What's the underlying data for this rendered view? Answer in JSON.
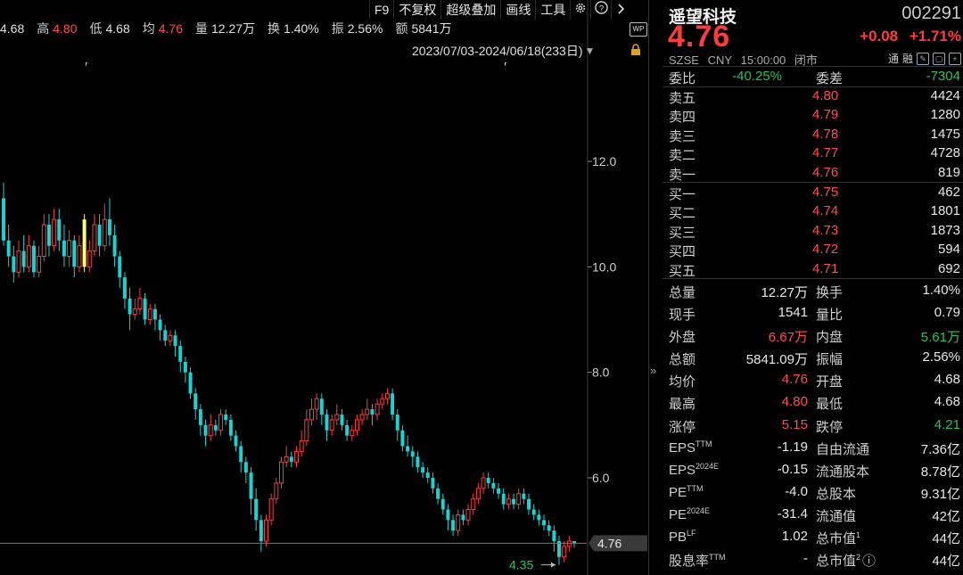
{
  "quote_bar": {
    "open_value": "4.68",
    "high_label": "高",
    "high_value": "4.80",
    "low_label": "低",
    "low_value": "4.68",
    "avg_label": "均",
    "avg_value": "4.76",
    "volume_label": "量",
    "volume_value": "12.27万",
    "turnover_label": "换",
    "turnover_value": "1.40%",
    "amplitude_label": "振",
    "amplitude_value": "2.56%",
    "amount_label": "额",
    "amount_value": "5841万"
  },
  "toolbar": {
    "f9": "F9",
    "no_adjust": "不复权",
    "overlay": "超级叠加",
    "draw": "画线",
    "tools": "工具",
    "wp_label": "WP"
  },
  "date_range": "2023/07/03-2024/06/18(233日)",
  "chart_data": {
    "type": "candlestick",
    "y_axis_ticks": [
      "12.0",
      "10.0",
      "8.0",
      "6.0"
    ],
    "ylim": [
      4.0,
      13.2
    ],
    "last_price_tag": "4.76",
    "min_marker": "4.35",
    "up_color": "#ff3b3b",
    "down_color": "#19d3d3",
    "highlight_color": "#ffff66",
    "candles": [
      [
        11.3,
        10.5,
        11.6,
        10.4
      ],
      [
        10.5,
        10.2,
        10.8,
        10.0
      ],
      [
        10.2,
        9.9,
        10.4,
        9.7
      ],
      [
        9.9,
        10.3,
        10.5,
        9.8
      ],
      [
        10.3,
        10.0,
        10.6,
        9.9
      ],
      [
        10.0,
        10.4,
        10.6,
        9.9
      ],
      [
        10.4,
        9.9,
        10.5,
        9.8
      ],
      [
        9.9,
        10.2,
        10.4,
        9.8
      ],
      [
        10.2,
        10.8,
        11.0,
        10.1
      ],
      [
        10.8,
        10.4,
        11.0,
        10.2
      ],
      [
        10.4,
        10.9,
        11.1,
        10.3
      ],
      [
        10.9,
        10.5,
        11.1,
        10.3
      ],
      [
        10.5,
        10.2,
        10.8,
        10.0
      ],
      [
        10.2,
        10.5,
        10.7,
        10.0
      ],
      [
        10.5,
        10.0,
        10.6,
        9.8
      ],
      [
        10.0,
        10.4,
        10.6,
        9.9
      ],
      [
        10.9,
        10.0,
        11.0,
        9.9
      ],
      [
        10.0,
        10.3,
        10.5,
        9.9
      ],
      [
        10.3,
        10.8,
        11.0,
        10.2
      ],
      [
        10.8,
        10.4,
        11.0,
        10.2
      ],
      [
        10.4,
        10.9,
        11.2,
        10.3
      ],
      [
        10.9,
        10.6,
        11.3,
        10.4
      ],
      [
        10.6,
        10.2,
        10.8,
        10.0
      ],
      [
        10.2,
        9.8,
        10.3,
        9.6
      ],
      [
        9.8,
        9.4,
        9.9,
        9.2
      ],
      [
        9.4,
        9.1,
        9.6,
        8.8
      ],
      [
        9.1,
        9.2,
        9.4,
        9.0
      ],
      [
        9.2,
        9.4,
        9.6,
        9.1
      ],
      [
        9.4,
        9.0,
        9.5,
        8.9
      ],
      [
        9.0,
        9.2,
        9.3,
        8.9
      ],
      [
        9.2,
        9.0,
        9.3,
        8.8
      ],
      [
        9.0,
        8.8,
        9.1,
        8.6
      ],
      [
        8.8,
        8.6,
        8.9,
        8.5
      ],
      [
        8.6,
        8.7,
        8.8,
        8.5
      ],
      [
        8.7,
        8.5,
        8.8,
        8.3
      ],
      [
        8.5,
        8.2,
        8.6,
        8.0
      ],
      [
        8.2,
        8.0,
        8.3,
        7.8
      ],
      [
        8.0,
        7.6,
        8.1,
        7.5
      ],
      [
        7.6,
        7.3,
        7.7,
        7.1
      ],
      [
        7.3,
        7.0,
        7.4,
        6.8
      ],
      [
        7.0,
        6.8,
        7.1,
        6.6
      ],
      [
        6.8,
        7.0,
        7.2,
        6.7
      ],
      [
        7.0,
        6.9,
        7.1,
        6.8
      ],
      [
        6.9,
        7.2,
        7.3,
        6.8
      ],
      [
        7.2,
        7.1,
        7.3,
        7.0
      ],
      [
        7.1,
        6.8,
        7.2,
        6.7
      ],
      [
        6.8,
        6.6,
        6.9,
        6.5
      ],
      [
        6.6,
        6.3,
        6.7,
        6.1
      ],
      [
        6.3,
        6.1,
        6.4,
        5.9
      ],
      [
        6.1,
        5.6,
        6.2,
        5.3
      ],
      [
        5.6,
        5.2,
        5.8,
        5.0
      ],
      [
        5.2,
        4.8,
        5.3,
        4.6
      ],
      [
        4.8,
        5.2,
        5.3,
        4.7
      ],
      [
        5.2,
        5.6,
        5.7,
        5.1
      ],
      [
        5.6,
        5.9,
        6.0,
        5.5
      ],
      [
        5.9,
        6.3,
        6.4,
        5.8
      ],
      [
        6.3,
        6.4,
        6.6,
        6.2
      ],
      [
        6.4,
        6.3,
        6.5,
        6.2
      ],
      [
        6.3,
        6.5,
        6.6,
        6.2
      ],
      [
        6.5,
        6.7,
        6.9,
        6.4
      ],
      [
        6.7,
        7.1,
        7.3,
        6.6
      ],
      [
        7.1,
        7.3,
        7.5,
        7.0
      ],
      [
        7.3,
        7.5,
        7.6,
        7.1
      ],
      [
        7.5,
        7.2,
        7.6,
        7.0
      ],
      [
        7.2,
        6.9,
        7.3,
        6.7
      ],
      [
        6.9,
        7.1,
        7.2,
        6.8
      ],
      [
        7.1,
        7.2,
        7.4,
        7.0
      ],
      [
        7.2,
        7.0,
        7.3,
        6.9
      ],
      [
        7.0,
        6.8,
        7.1,
        6.7
      ],
      [
        6.8,
        6.9,
        7.0,
        6.7
      ],
      [
        6.9,
        7.1,
        7.2,
        6.8
      ],
      [
        7.1,
        7.2,
        7.3,
        7.0
      ],
      [
        7.2,
        7.3,
        7.5,
        7.1
      ],
      [
        7.3,
        7.2,
        7.4,
        7.0
      ],
      [
        7.2,
        7.4,
        7.5,
        7.1
      ],
      [
        7.4,
        7.5,
        7.6,
        7.3
      ],
      [
        7.5,
        7.6,
        7.7,
        7.4
      ],
      [
        7.6,
        7.2,
        7.7,
        7.1
      ],
      [
        7.2,
        6.9,
        7.3,
        6.7
      ],
      [
        6.9,
        6.6,
        7.0,
        6.5
      ],
      [
        6.6,
        6.5,
        6.8,
        6.4
      ],
      [
        6.5,
        6.4,
        6.6,
        6.2
      ],
      [
        6.4,
        6.2,
        6.5,
        6.1
      ],
      [
        6.2,
        6.1,
        6.3,
        6.0
      ],
      [
        6.1,
        6.0,
        6.2,
        5.9
      ],
      [
        6.0,
        5.8,
        6.1,
        5.7
      ],
      [
        5.8,
        5.6,
        5.9,
        5.5
      ],
      [
        5.6,
        5.4,
        5.7,
        5.3
      ],
      [
        5.4,
        5.2,
        5.5,
        5.0
      ],
      [
        5.2,
        5.0,
        5.3,
        4.9
      ],
      [
        5.0,
        5.3,
        5.4,
        4.9
      ],
      [
        5.3,
        5.2,
        5.4,
        5.1
      ],
      [
        5.2,
        5.4,
        5.5,
        5.1
      ],
      [
        5.4,
        5.6,
        5.7,
        5.3
      ],
      [
        5.6,
        5.8,
        5.9,
        5.5
      ],
      [
        5.8,
        6.0,
        6.1,
        5.7
      ],
      [
        6.0,
        5.9,
        6.1,
        5.8
      ],
      [
        5.9,
        5.8,
        6.0,
        5.7
      ],
      [
        5.8,
        5.7,
        5.9,
        5.6
      ],
      [
        5.7,
        5.5,
        5.8,
        5.4
      ],
      [
        5.5,
        5.6,
        5.7,
        5.4
      ],
      [
        5.6,
        5.5,
        5.7,
        5.4
      ],
      [
        5.5,
        5.7,
        5.8,
        5.4
      ],
      [
        5.7,
        5.6,
        5.8,
        5.5
      ],
      [
        5.6,
        5.4,
        5.7,
        5.3
      ],
      [
        5.4,
        5.3,
        5.5,
        5.2
      ],
      [
        5.3,
        5.2,
        5.4,
        5.1
      ],
      [
        5.2,
        5.1,
        5.3,
        5.0
      ],
      [
        5.1,
        5.0,
        5.2,
        4.9
      ],
      [
        5.0,
        4.8,
        5.1,
        4.6
      ],
      [
        4.8,
        4.5,
        4.9,
        4.35
      ],
      [
        4.5,
        4.7,
        4.8,
        4.4
      ],
      [
        4.7,
        4.8,
        4.9,
        4.6
      ],
      [
        4.8,
        4.76,
        4.8,
        4.68
      ]
    ]
  },
  "panel": {
    "name": "遥望科技",
    "code": "002291",
    "price": "4.76",
    "change": "+0.08",
    "change_pct": "+1.71%",
    "exchange": "SZSE",
    "currency": "CNY",
    "time": "15:00:00",
    "status": "闭市",
    "tag1": "通",
    "tag2": "融",
    "ratio_label": "委比",
    "ratio_value": "-40.25%",
    "diff_label": "委差",
    "diff_value": "-7304",
    "asks": [
      {
        "label": "卖五",
        "price": "4.80",
        "vol": "4424"
      },
      {
        "label": "卖四",
        "price": "4.79",
        "vol": "1280"
      },
      {
        "label": "卖三",
        "price": "4.78",
        "vol": "1475"
      },
      {
        "label": "卖二",
        "price": "4.77",
        "vol": "4728"
      },
      {
        "label": "卖一",
        "price": "4.76",
        "vol": "819"
      }
    ],
    "bids": [
      {
        "label": "买一",
        "price": "4.75",
        "vol": "462"
      },
      {
        "label": "买二",
        "price": "4.74",
        "vol": "1801"
      },
      {
        "label": "买三",
        "price": "4.73",
        "vol": "1873"
      },
      {
        "label": "买四",
        "price": "4.72",
        "vol": "594"
      },
      {
        "label": "买五",
        "price": "4.71",
        "vol": "692"
      }
    ],
    "stats": [
      {
        "l1": "总量",
        "v1": "12.27万",
        "c1": "white",
        "l2": "换手",
        "v2": "1.40%",
        "c2": "white"
      },
      {
        "l1": "现手",
        "v1": "1541",
        "c1": "white",
        "l2": "量比",
        "v2": "0.79",
        "c2": "white"
      },
      {
        "l1": "外盘",
        "v1": "6.67万",
        "c1": "red",
        "l2": "内盘",
        "v2": "5.61万",
        "c2": "green"
      },
      {
        "l1": "总额",
        "v1": "5841.09万",
        "c1": "white",
        "l2": "振幅",
        "v2": "2.56%",
        "c2": "white"
      },
      {
        "l1": "均价",
        "v1": "4.76",
        "c1": "red",
        "l2": "开盘",
        "v2": "4.68",
        "c2": "white"
      },
      {
        "l1": "最高",
        "v1": "4.80",
        "c1": "red",
        "l2": "最低",
        "v2": "4.68",
        "c2": "white"
      },
      {
        "l1": "涨停",
        "v1": "5.15",
        "c1": "red",
        "l2": "跌停",
        "v2": "4.21",
        "c2": "green"
      },
      {
        "l1": "EPS",
        "s1": "TTM",
        "v1": "-1.19",
        "c1": "white",
        "l2": "自由流通",
        "v2": "7.36亿",
        "c2": "white"
      },
      {
        "l1": "EPS",
        "s1": "2024E",
        "v1": "-0.15",
        "c1": "white",
        "l2": "流通股本",
        "v2": "8.78亿",
        "c2": "white"
      },
      {
        "l1": "PE",
        "s1": "TTM",
        "v1": "-4.0",
        "c1": "white",
        "l2": "总股本",
        "v2": "9.31亿",
        "c2": "white"
      },
      {
        "l1": "PE",
        "s1": "2024E",
        "v1": "-31.4",
        "c1": "white",
        "l2": "流通值",
        "v2": "42亿",
        "c2": "white"
      },
      {
        "l1": "PB",
        "s1": "LF",
        "v1": "1.02",
        "c1": "white",
        "l2": "总市值",
        "s2": "1",
        "v2": "44亿",
        "c2": "white"
      },
      {
        "l1": "股息率",
        "s1": "TTM",
        "v1": "-",
        "c1": "white",
        "l2": "总市值",
        "s2": "2",
        "v2": "44亿",
        "c2": "white",
        "info": "ⓘ"
      }
    ]
  }
}
